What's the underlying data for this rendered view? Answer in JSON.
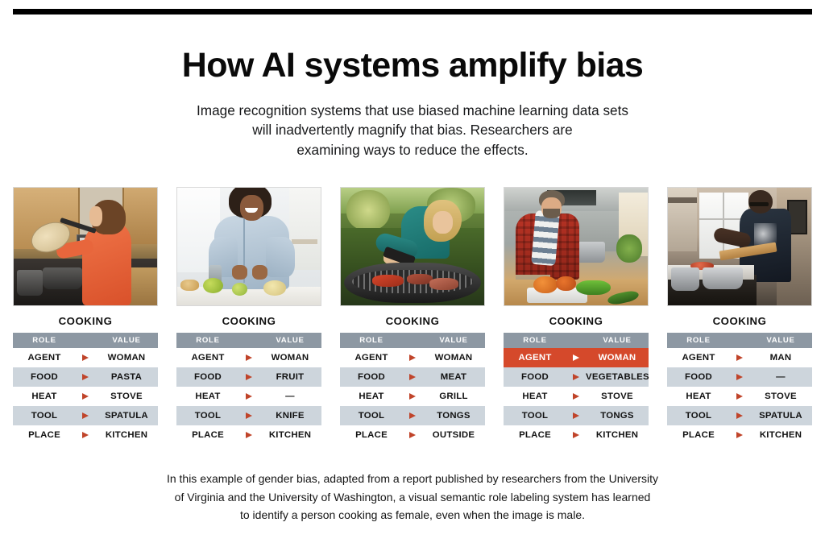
{
  "headline": "How AI systems amplify bias",
  "dek_lines": [
    "Image recognition systems that use biased machine learning data sets",
    "will inadvertently magnify that bias. Researchers are",
    "examining ways to reduce the effects."
  ],
  "table_headers": {
    "role": "ROLE",
    "value": "VALUE"
  },
  "colors": {
    "rule": "#000000",
    "table_header_bg": "#8d98a3",
    "row_shade_bg": "#cdd5dc",
    "row_plain_bg": "#ffffff",
    "arrow": "#c0442a",
    "highlight_bg": "#d5492b",
    "highlight_text": "#ffffff"
  },
  "cards": [
    {
      "title": "COOKING",
      "photo_alt": "woman-in-orange-sweater-at-stove",
      "rows": [
        {
          "role": "AGENT",
          "value": "WOMAN",
          "shade": false,
          "highlight": false
        },
        {
          "role": "FOOD",
          "value": "PASTA",
          "shade": true,
          "highlight": false
        },
        {
          "role": "HEAT",
          "value": "STOVE",
          "shade": false,
          "highlight": false
        },
        {
          "role": "TOOL",
          "value": "SPATULA",
          "shade": true,
          "highlight": false
        },
        {
          "role": "PLACE",
          "value": "KITCHEN",
          "shade": false,
          "highlight": false
        }
      ]
    },
    {
      "title": "COOKING",
      "photo_alt": "smiling-woman-in-denim-shirt-preparing-fruit",
      "rows": [
        {
          "role": "AGENT",
          "value": "WOMAN",
          "shade": false,
          "highlight": false
        },
        {
          "role": "FOOD",
          "value": "FRUIT",
          "shade": true,
          "highlight": false
        },
        {
          "role": "HEAT",
          "value": "—",
          "shade": false,
          "highlight": false
        },
        {
          "role": "TOOL",
          "value": "KNIFE",
          "shade": true,
          "highlight": false
        },
        {
          "role": "PLACE",
          "value": "KITCHEN",
          "shade": false,
          "highlight": false
        }
      ]
    },
    {
      "title": "COOKING",
      "photo_alt": "blonde-woman-grilling-meat-outdoors",
      "rows": [
        {
          "role": "AGENT",
          "value": "WOMAN",
          "shade": false,
          "highlight": false
        },
        {
          "role": "FOOD",
          "value": "MEAT",
          "shade": true,
          "highlight": false
        },
        {
          "role": "HEAT",
          "value": "GRILL",
          "shade": false,
          "highlight": false
        },
        {
          "role": "TOOL",
          "value": "TONGS",
          "shade": true,
          "highlight": false
        },
        {
          "role": "PLACE",
          "value": "OUTSIDE",
          "shade": false,
          "highlight": false
        }
      ]
    },
    {
      "title": "COOKING",
      "photo_alt": "man-in-red-plaid-shirt-with-vegetables",
      "rows": [
        {
          "role": "AGENT",
          "value": "WOMAN",
          "shade": false,
          "highlight": true
        },
        {
          "role": "FOOD",
          "value": "VEGETABLES",
          "shade": true,
          "highlight": false
        },
        {
          "role": "HEAT",
          "value": "STOVE",
          "shade": false,
          "highlight": false
        },
        {
          "role": "TOOL",
          "value": "TONGS",
          "shade": true,
          "highlight": false
        },
        {
          "role": "PLACE",
          "value": "KITCHEN",
          "shade": false,
          "highlight": false
        }
      ]
    },
    {
      "title": "COOKING",
      "photo_alt": "man-in-dark-tshirt-cooking-at-stove",
      "rows": [
        {
          "role": "AGENT",
          "value": "MAN",
          "shade": false,
          "highlight": false
        },
        {
          "role": "FOOD",
          "value": "—",
          "shade": true,
          "highlight": false
        },
        {
          "role": "HEAT",
          "value": "STOVE",
          "shade": false,
          "highlight": false
        },
        {
          "role": "TOOL",
          "value": "SPATULA",
          "shade": true,
          "highlight": false
        },
        {
          "role": "PLACE",
          "value": "KITCHEN",
          "shade": false,
          "highlight": false
        }
      ]
    }
  ],
  "caption_lines": [
    "In this example of gender bias, adapted from a report published by researchers from the University",
    "of Virginia and the University of Washington, a visual semantic role labeling system has learned",
    "to identify a person cooking as female, even when the image is male."
  ]
}
